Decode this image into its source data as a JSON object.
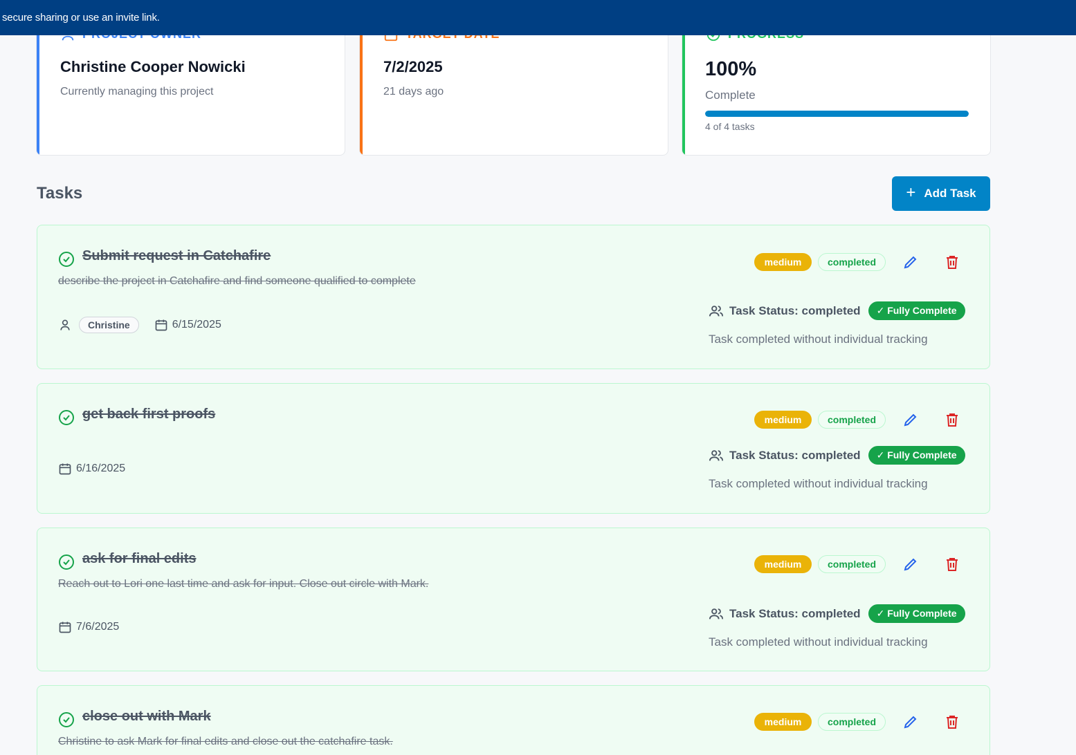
{
  "banner": {
    "text": "secure sharing or use an invite link."
  },
  "colors": {
    "owner_accent": "#3b82f6",
    "date_accent": "#f97316",
    "progress_accent": "#22c55e",
    "primary": "#0284c7"
  },
  "cards": {
    "owner": {
      "label": "PROJECT OWNER",
      "name": "Christine Cooper Nowicki",
      "sub": "Currently managing this project",
      "icon": "user-icon"
    },
    "target": {
      "label": "TARGET DATE",
      "date": "7/2/2025",
      "sub": "21 days ago",
      "icon": "calendar-icon"
    },
    "progress": {
      "label": "PROGRESS",
      "percent_text": "100%",
      "percent_value": 100,
      "complete_label": "Complete",
      "count": "4 of 4 tasks",
      "icon": "circle-check-icon"
    }
  },
  "tasks_section": {
    "heading": "Tasks",
    "add_button": "Add Task"
  },
  "tasks": [
    {
      "title": "Submit request in Catchafire",
      "description": "describe the project in Catchafire and find someone qualified to complete",
      "assignee": "Christine",
      "due": "6/15/2025",
      "priority": "medium",
      "status": "completed",
      "task_status": "Task Status: completed",
      "complete_badge": "✓ Fully Complete",
      "note": "Task completed without individual tracking"
    },
    {
      "title": "get back first proofs",
      "description": "",
      "assignee": "",
      "due": "6/16/2025",
      "priority": "medium",
      "status": "completed",
      "task_status": "Task Status: completed",
      "complete_badge": "✓ Fully Complete",
      "note": "Task completed without individual tracking"
    },
    {
      "title": "ask for final edits",
      "description": "Reach out to Lori one last time and ask for input. Close out circle with Mark.",
      "assignee": "",
      "due": "7/6/2025",
      "priority": "medium",
      "status": "completed",
      "task_status": "Task Status: completed",
      "complete_badge": "✓ Fully Complete",
      "note": "Task completed without individual tracking"
    },
    {
      "title": "close out with Mark",
      "description": "Christine to ask Mark for final edits and close out the catchafire task.",
      "assignee": "",
      "due": "",
      "priority": "medium",
      "status": "completed",
      "task_status": "",
      "complete_badge": "",
      "note": ""
    }
  ]
}
